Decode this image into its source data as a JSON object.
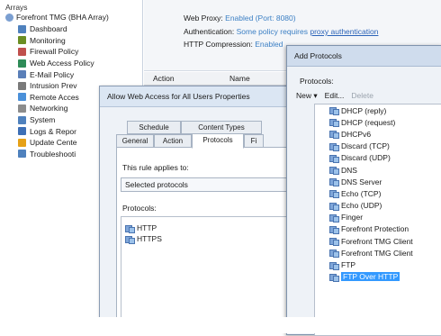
{
  "tree": {
    "header": "Arrays",
    "root": "Forefront TMG (BHA Array)",
    "items": [
      {
        "label": "Dashboard",
        "icon": "dashboard-icon",
        "color": "#4f81bd"
      },
      {
        "label": "Monitoring",
        "icon": "monitoring-icon",
        "color": "#6b8e23"
      },
      {
        "label": "Firewall Policy",
        "icon": "firewall-policy-icon",
        "color": "#c0504d"
      },
      {
        "label": "Web Access Policy",
        "icon": "web-access-policy-icon",
        "color": "#2e8b57"
      },
      {
        "label": "E-Mail Policy",
        "icon": "email-policy-icon",
        "color": "#5a7fb8"
      },
      {
        "label": "Intrusion Prev",
        "icon": "intrusion-prevention-icon",
        "color": "#7a7a7a"
      },
      {
        "label": "Remote Acces",
        "icon": "remote-access-icon",
        "color": "#4a90d9"
      },
      {
        "label": "Networking",
        "icon": "networking-icon",
        "color": "#8c8c8c"
      },
      {
        "label": "System",
        "icon": "system-icon",
        "color": "#4f81bd"
      },
      {
        "label": "Logs & Repor",
        "icon": "logs-reports-icon",
        "color": "#3d6fb6"
      },
      {
        "label": "Update Cente",
        "icon": "update-center-icon",
        "color": "#e6a117"
      },
      {
        "label": "Troubleshooti",
        "icon": "troubleshooting-icon",
        "color": "#4f81bd"
      }
    ]
  },
  "info": {
    "web_proxy_label": "Web Proxy:",
    "web_proxy_value": "Enabled (Port: 8080)",
    "auth_label": "Authentication:",
    "auth_value": "Some policy requires",
    "auth_link": "proxy authentication",
    "http_comp_label": "HTTP Compression:",
    "http_comp_value": "Enabled"
  },
  "columns": [
    "Action",
    "Name"
  ],
  "props_dialog": {
    "title": "Allow Web Access for All Users Properties",
    "tabs_row1": [
      "Schedule",
      "Content Types"
    ],
    "tabs_row2": [
      "General",
      "Action",
      "Protocols",
      "Fi"
    ],
    "active_tab": "Protocols",
    "applies_label": "This rule applies to:",
    "applies_value": "Selected protocols",
    "protocols_label": "Protocols:",
    "protocols": [
      "HTTP",
      "HTTPS"
    ]
  },
  "add_dialog": {
    "title": "Add Protocols",
    "protocols_label": "Protocols:",
    "toolbar": {
      "new": "New",
      "edit": "Edit...",
      "delete": "Delete"
    },
    "items": [
      "DHCP (reply)",
      "DHCP (request)",
      "DHCPv6",
      "Discard (TCP)",
      "Discard (UDP)",
      "DNS",
      "DNS Server",
      "Echo (TCP)",
      "Echo (UDP)",
      "Finger",
      "Forefront Protection",
      "Forefront TMG Client",
      "Forefront TMG Client",
      "FTP",
      "FTP Over HTTP"
    ],
    "selected": "FTP Over HTTP",
    "selection_color": "#3399ff"
  }
}
